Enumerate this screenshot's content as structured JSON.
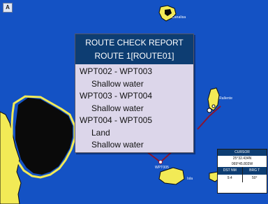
{
  "map": {
    "corner_icon": "A",
    "labels": [
      {
        "id": "island-top",
        "text": "Canalisa"
      },
      {
        "id": "island-right",
        "text": "Rallente"
      },
      {
        "id": "waypoint-bottom",
        "text": "WPT005"
      },
      {
        "id": "island-bottom",
        "text": "Isla"
      }
    ],
    "colors": {
      "sea": "#1452c4",
      "land": "#f2ea56",
      "land_dark": "#0a0a0a",
      "route": "#8a1530"
    }
  },
  "report": {
    "title": "ROUTE CHECK REPORT",
    "route": "ROUTE 1[ROUTE01]",
    "lines": [
      {
        "text": "WPT002 - WPT003",
        "indent": false
      },
      {
        "text": "Shallow water",
        "indent": true
      },
      {
        "text": "WPT003 - WPT004",
        "indent": false
      },
      {
        "text": "Shallow water",
        "indent": true
      },
      {
        "text": "WPT004 - WPT005",
        "indent": false
      },
      {
        "text": "Land",
        "indent": true
      },
      {
        "text": "Shallow water",
        "indent": true
      }
    ]
  },
  "cursor": {
    "header": "CURSOR",
    "lat": "25°32.434N",
    "lon": "069°45.803W",
    "dst_label": "DST NM",
    "brg_label": "BRG T",
    "dst_value": "9.4",
    "brg_value": "50°"
  }
}
